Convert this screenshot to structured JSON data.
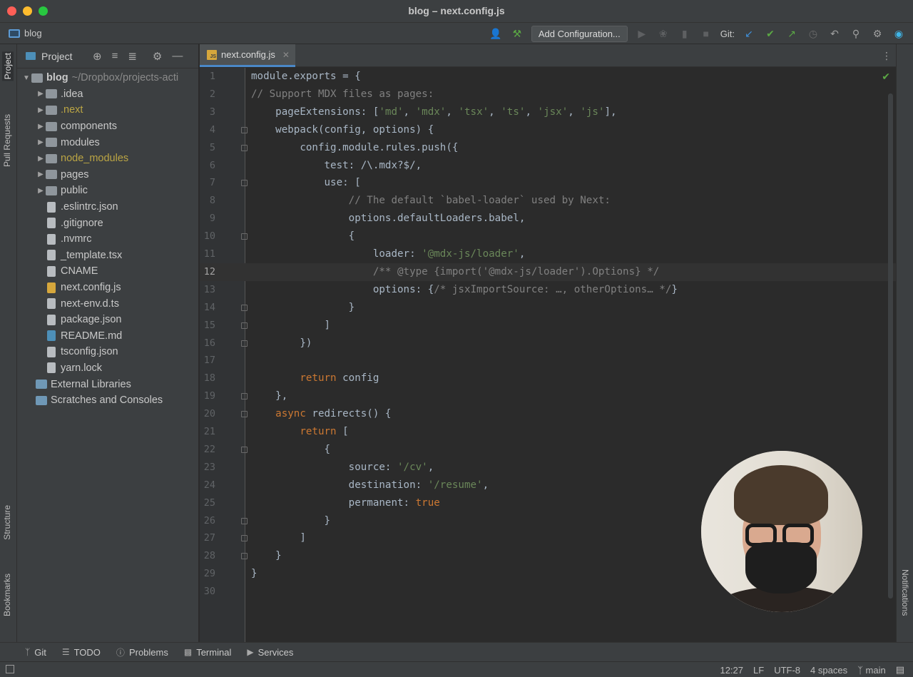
{
  "window": {
    "title": "blog – next.config.js"
  },
  "toolbar": {
    "project_name": "blog",
    "add_configuration": "Add Configuration...",
    "git_label": "Git:"
  },
  "left_strip": {
    "project": "Project",
    "pull_requests": "Pull Requests",
    "structure": "Structure",
    "bookmarks": "Bookmarks"
  },
  "right_strip": {
    "notifications": "Notifications"
  },
  "project_panel": {
    "title": "Project",
    "root": {
      "name": "blog",
      "path": "~/Dropbox/projects-acti"
    },
    "items": [
      {
        "name": ".idea",
        "kind": "folder"
      },
      {
        "name": ".next",
        "kind": "folder-excluded"
      },
      {
        "name": "components",
        "kind": "folder"
      },
      {
        "name": "modules",
        "kind": "folder"
      },
      {
        "name": "node_modules",
        "kind": "folder-excluded"
      },
      {
        "name": "pages",
        "kind": "folder"
      },
      {
        "name": "public",
        "kind": "folder"
      },
      {
        "name": ".eslintrc.json",
        "kind": "file"
      },
      {
        "name": ".gitignore",
        "kind": "file"
      },
      {
        "name": ".nvmrc",
        "kind": "file"
      },
      {
        "name": "_template.tsx",
        "kind": "file"
      },
      {
        "name": "CNAME",
        "kind": "file"
      },
      {
        "name": "next.config.js",
        "kind": "file-js"
      },
      {
        "name": "next-env.d.ts",
        "kind": "file"
      },
      {
        "name": "package.json",
        "kind": "file"
      },
      {
        "name": "README.md",
        "kind": "file-md"
      },
      {
        "name": "tsconfig.json",
        "kind": "file"
      },
      {
        "name": "yarn.lock",
        "kind": "file"
      }
    ],
    "external_libraries": "External Libraries",
    "scratches": "Scratches and Consoles"
  },
  "editor": {
    "tab_label": "next.config.js",
    "tab_badge": "JS",
    "lines": [
      {
        "n": "1",
        "t": "module.exports = {"
      },
      {
        "n": "2",
        "t": "// Support MDX files as pages:"
      },
      {
        "n": "3",
        "t": "    pageExtensions: ['md', 'mdx', 'tsx', 'ts', 'jsx', 'js'],"
      },
      {
        "n": "4",
        "t": "    webpack(config, options) {"
      },
      {
        "n": "5",
        "t": "        config.module.rules.push({"
      },
      {
        "n": "6",
        "t": "            test: /\\.mdx?$/,"
      },
      {
        "n": "7",
        "t": "            use: ["
      },
      {
        "n": "8",
        "t": "                // The default `babel-loader` used by Next:"
      },
      {
        "n": "9",
        "t": "                options.defaultLoaders.babel,"
      },
      {
        "n": "10",
        "t": "                {"
      },
      {
        "n": "11",
        "t": "                    loader: '@mdx-js/loader',"
      },
      {
        "n": "12",
        "t": "                    /** @type {import('@mdx-js/loader').Options} */"
      },
      {
        "n": "13",
        "t": "                    options: {/* jsxImportSource: …, otherOptions… */}"
      },
      {
        "n": "14",
        "t": "                }"
      },
      {
        "n": "15",
        "t": "            ]"
      },
      {
        "n": "16",
        "t": "        })"
      },
      {
        "n": "17",
        "t": ""
      },
      {
        "n": "18",
        "t": "        return config"
      },
      {
        "n": "19",
        "t": "    },"
      },
      {
        "n": "20",
        "t": "    async redirects() {"
      },
      {
        "n": "21",
        "t": "        return ["
      },
      {
        "n": "22",
        "t": "            {"
      },
      {
        "n": "23",
        "t": "                source: '/cv',"
      },
      {
        "n": "24",
        "t": "                destination: '/resume',"
      },
      {
        "n": "25",
        "t": "                permanent: true"
      },
      {
        "n": "26",
        "t": "            }"
      },
      {
        "n": "27",
        "t": "        ]"
      },
      {
        "n": "28",
        "t": "    }"
      },
      {
        "n": "29",
        "t": "}"
      },
      {
        "n": "30",
        "t": ""
      }
    ]
  },
  "bottom_tools": {
    "git": "Git",
    "todo": "TODO",
    "problems": "Problems",
    "terminal": "Terminal",
    "services": "Services"
  },
  "status": {
    "position": "12:27",
    "line_sep": "LF",
    "encoding": "UTF-8",
    "indent": "4 spaces",
    "branch": "main"
  }
}
